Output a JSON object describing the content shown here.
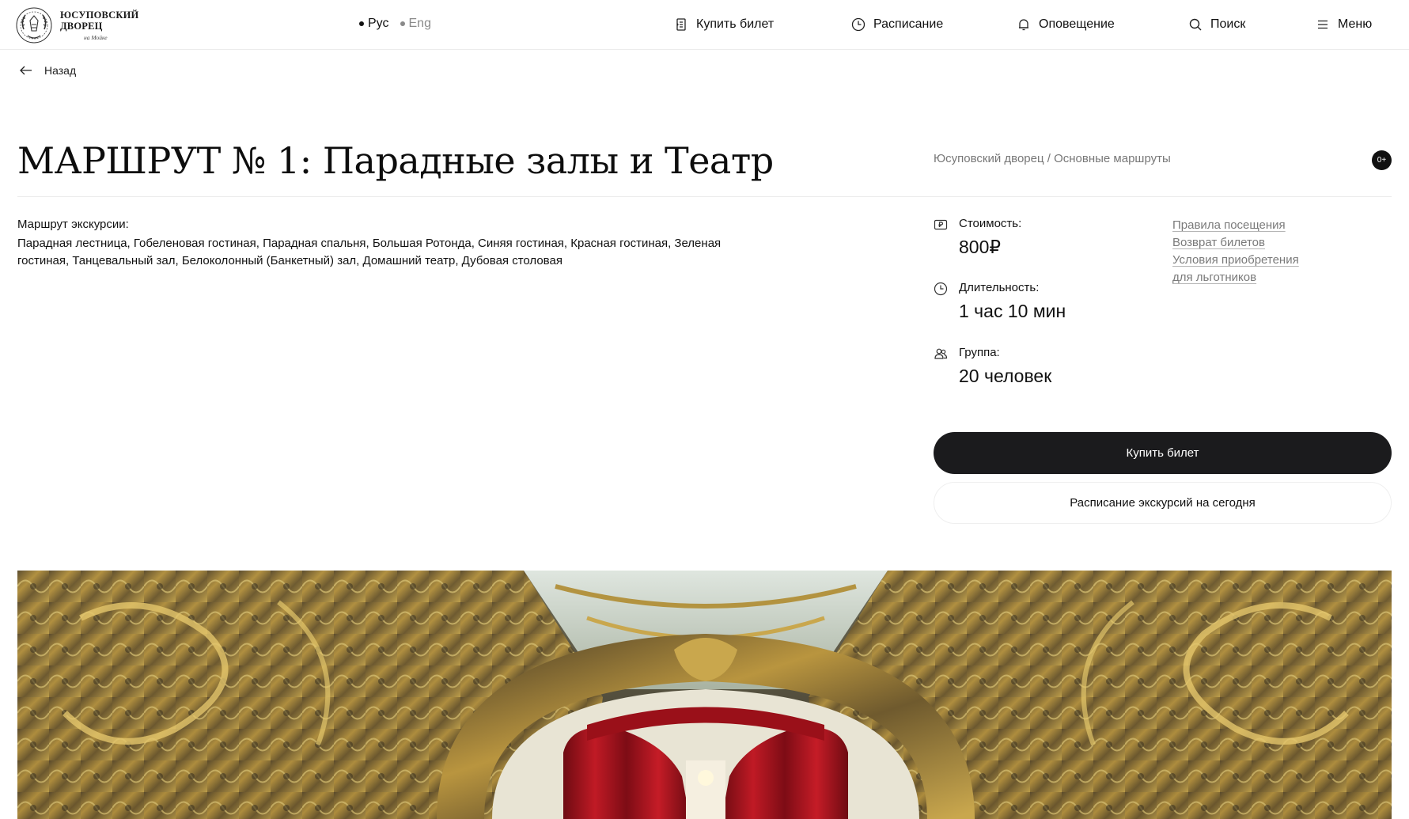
{
  "header": {
    "logo": {
      "line1": "ЮСУПОВСКИЙ",
      "line2": "ДВОРЕЦ",
      "line3": "на Мойке"
    },
    "languages": [
      {
        "label": "Рус",
        "active": true
      },
      {
        "label": "Eng",
        "active": false
      }
    ],
    "nav": {
      "buy_ticket": "Купить билет",
      "schedule": "Расписание",
      "notification": "Оповещение",
      "search": "Поиск",
      "menu": "Меню"
    }
  },
  "back_label": "Назад",
  "page": {
    "title": "МАРШРУТ № 1: Парадные залы и Театр",
    "breadcrumb": "Юсуповский дворец / Основные маршруты",
    "age_rating": "0+",
    "route_label": "Маршрут экскурсии:",
    "route_text": "Парадная лестница, Гобеленовая гостиная, Парадная спальня, Большая Ротонда, Синяя гостиная, Красная гостиная, Зеленая гостиная, Танцевальный зал, Белоколонный (Банкетный) зал, Домашний театр, Дубовая столовая"
  },
  "info": {
    "price": {
      "label": "Стоимость:",
      "value": "800₽",
      "icon": "ruble-card-icon"
    },
    "duration": {
      "label": "Длительность:",
      "value": "1 час 10 мин",
      "icon": "clock-icon"
    },
    "group": {
      "label": "Группа:",
      "value": "20 человек",
      "icon": "people-icon"
    }
  },
  "links": [
    "Правила посещения",
    "Возврат билетов",
    "Условия приобретения",
    "для льготников"
  ],
  "buttons": {
    "buy": "Купить билет",
    "schedule_today": "Расписание экскурсий на сегодня"
  },
  "hero_image": "ornate gilded theatre interior with red stage curtain",
  "colors": {
    "primary_button": "#1b1b1d",
    "link": "#7a7a7a",
    "muted": "#777777"
  }
}
